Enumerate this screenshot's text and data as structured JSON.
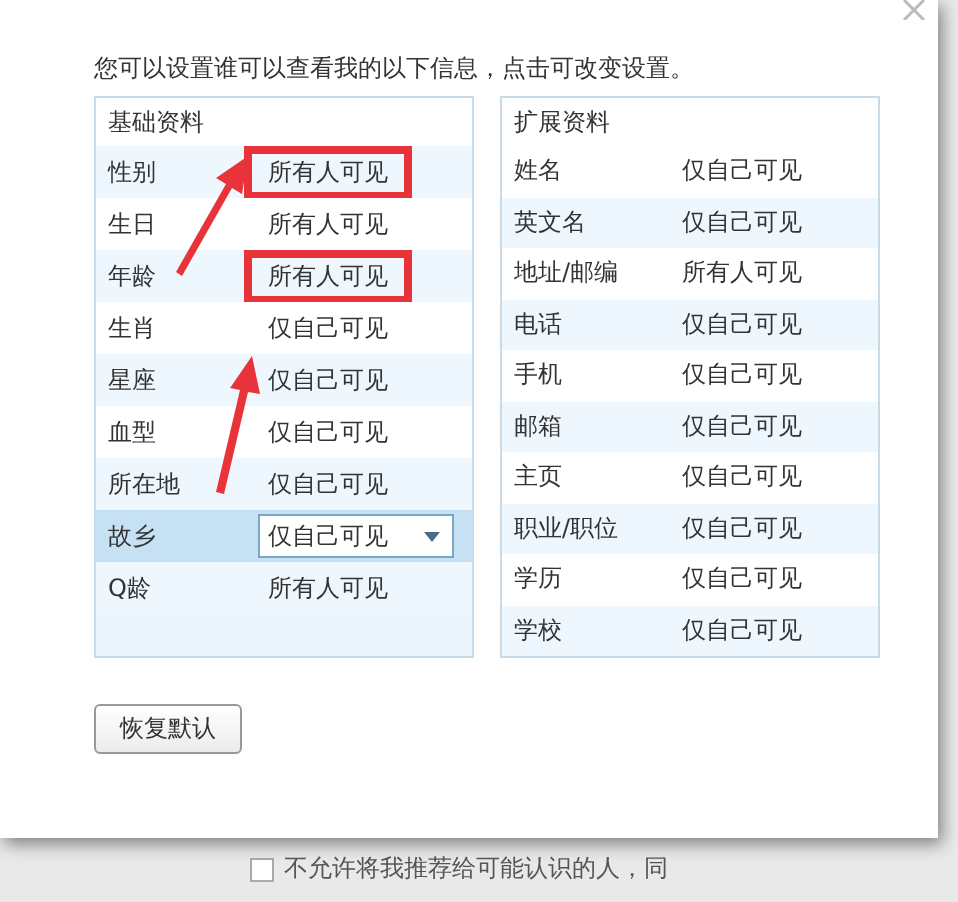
{
  "dialog": {
    "intro": "您可以设置谁可以查看我的以下信息，点击可改变设置。",
    "basic": {
      "title": "基础资料",
      "rows": [
        {
          "field": "性别",
          "visibility": "所有人可见",
          "selected": false,
          "highlighted": true
        },
        {
          "field": "生日",
          "visibility": "所有人可见",
          "selected": false,
          "highlighted": false
        },
        {
          "field": "年龄",
          "visibility": "所有人可见",
          "selected": false,
          "highlighted": true
        },
        {
          "field": "生肖",
          "visibility": "仅自己可见",
          "selected": false,
          "highlighted": false
        },
        {
          "field": "星座",
          "visibility": "仅自己可见",
          "selected": false,
          "highlighted": false
        },
        {
          "field": "血型",
          "visibility": "仅自己可见",
          "selected": false,
          "highlighted": false
        },
        {
          "field": "所在地",
          "visibility": "仅自己可见",
          "selected": false,
          "highlighted": false
        },
        {
          "field": "故乡",
          "visibility": "仅自己可见",
          "selected": true,
          "highlighted": false
        },
        {
          "field": "Q龄",
          "visibility": "所有人可见",
          "selected": false,
          "highlighted": false
        }
      ]
    },
    "extended": {
      "title": "扩展资料",
      "rows": [
        {
          "field": "姓名",
          "visibility": "仅自己可见",
          "selected": false,
          "highlighted": false
        },
        {
          "field": "英文名",
          "visibility": "仅自己可见",
          "selected": false,
          "highlighted": false
        },
        {
          "field": "地址/邮编",
          "visibility": "所有人可见",
          "selected": false,
          "highlighted": false
        },
        {
          "field": "电话",
          "visibility": "仅自己可见",
          "selected": false,
          "highlighted": false
        },
        {
          "field": "手机",
          "visibility": "仅自己可见",
          "selected": false,
          "highlighted": false
        },
        {
          "field": "邮箱",
          "visibility": "仅自己可见",
          "selected": false,
          "highlighted": false
        },
        {
          "field": "主页",
          "visibility": "仅自己可见",
          "selected": false,
          "highlighted": false
        },
        {
          "field": "职业/职位",
          "visibility": "仅自己可见",
          "selected": false,
          "highlighted": false
        },
        {
          "field": "学历",
          "visibility": "仅自己可见",
          "selected": false,
          "highlighted": false
        },
        {
          "field": "学校",
          "visibility": "仅自己可见",
          "selected": false,
          "highlighted": false
        }
      ]
    },
    "reset_button": "恢复默认"
  },
  "background": {
    "checkbox": {
      "label": "不允许将我推荐给可能认识的人，同",
      "checked": false
    }
  }
}
